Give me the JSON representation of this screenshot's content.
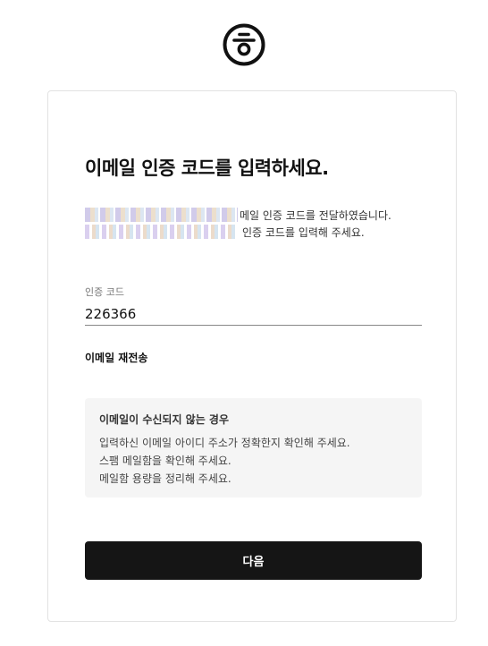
{
  "brand": {
    "logo_icon": "circle-hieut-logo-icon"
  },
  "page": {
    "title": "이메일 인증 코드를 입력하세요.",
    "notice_line1": "메일 인증 코드를 전달하였습니다.",
    "notice_line2": "인증 코드를 입력해 주세요."
  },
  "form": {
    "code_label": "인증 코드",
    "code_value": "226366",
    "resend_label": "이메일 재전송",
    "next_label": "다음"
  },
  "help": {
    "title": "이메일이 수신되지 않는 경우",
    "items": [
      "입력하신 이메일 아이디 주소가 정확한지 확인해 주세요.",
      "스팸 메일함을 확인해 주세요.",
      "메일함 용량을 정리해 주세요."
    ]
  },
  "colors": {
    "button_bg": "#151515",
    "help_bg": "#f5f5f5",
    "card_border": "#e2e2e2"
  }
}
